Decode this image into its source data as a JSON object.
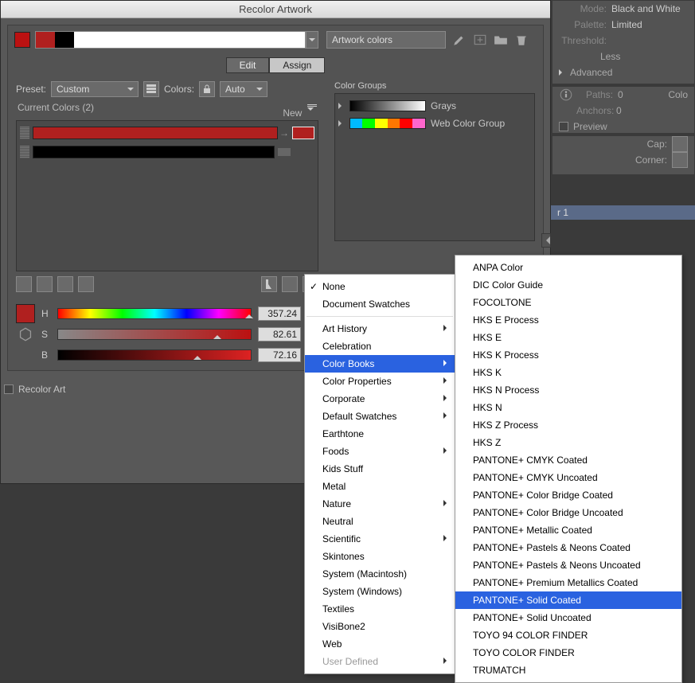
{
  "dialog_title": "Recolor Artwork",
  "top": {
    "artwork_field": "Artwork colors"
  },
  "tabs": {
    "edit": "Edit",
    "assign": "Assign"
  },
  "preset": {
    "label": "Preset:",
    "value": "Custom",
    "colors_label": "Colors:",
    "colors_value": "Auto"
  },
  "current": {
    "label": "Current Colors (2)",
    "new": "New"
  },
  "color_rows": [
    {
      "current": "#b0201f",
      "target": "#b0201f"
    },
    {
      "current": "#000000",
      "target": null
    }
  ],
  "hsb": {
    "swatch": "#b0201f",
    "H": {
      "label": "H",
      "value": "357.24",
      "unit": "°"
    },
    "S": {
      "label": "S",
      "value": "82.61",
      "unit": "%"
    },
    "B": {
      "label": "B",
      "value": "72.16",
      "unit": "%"
    }
  },
  "recolor_label": "Recolor Art",
  "groups": {
    "label": "Color Groups",
    "items": [
      {
        "name": "Grays"
      },
      {
        "name": "Web Color Group"
      }
    ]
  },
  "side": {
    "mode_label": "Mode:",
    "mode_value": "Black and White",
    "palette_label": "Palette:",
    "palette_value": "Limited",
    "threshold_label": "Threshold:",
    "threshold_less": "Less",
    "advanced": "Advanced",
    "paths_label": "Paths:",
    "paths_value": "0",
    "colors_label": "Colo",
    "anchors_label": "Anchors:",
    "anchors_value": "0",
    "preview": "Preview",
    "cap_label": "Cap:",
    "corner_label": "Corner:"
  },
  "layer": "r 1",
  "menu1": [
    {
      "label": "None",
      "checked": true
    },
    {
      "label": "Document Swatches"
    },
    {
      "sep": true
    },
    {
      "label": "Art History",
      "sub": true
    },
    {
      "label": "Celebration"
    },
    {
      "label": "Color Books",
      "sub": true,
      "selected": true
    },
    {
      "label": "Color Properties",
      "sub": true
    },
    {
      "label": "Corporate",
      "sub": true
    },
    {
      "label": "Default Swatches",
      "sub": true
    },
    {
      "label": "Earthtone"
    },
    {
      "label": "Foods",
      "sub": true
    },
    {
      "label": "Kids Stuff"
    },
    {
      "label": "Metal"
    },
    {
      "label": "Nature",
      "sub": true
    },
    {
      "label": "Neutral"
    },
    {
      "label": "Scientific",
      "sub": true
    },
    {
      "label": "Skintones"
    },
    {
      "label": "System (Macintosh)"
    },
    {
      "label": "System (Windows)"
    },
    {
      "label": "Textiles"
    },
    {
      "label": "VisiBone2"
    },
    {
      "label": "Web"
    },
    {
      "label": "User Defined",
      "sub": true,
      "disabled": true
    }
  ],
  "menu2": [
    "ANPA Color",
    "DIC Color Guide",
    "FOCOLTONE",
    "HKS E Process",
    "HKS E",
    "HKS K Process",
    "HKS K",
    "HKS N Process",
    "HKS N",
    "HKS Z Process",
    "HKS Z",
    "PANTONE+ CMYK Coated",
    "PANTONE+ CMYK Uncoated",
    "PANTONE+ Color Bridge Coated",
    "PANTONE+ Color Bridge Uncoated",
    "PANTONE+ Metallic Coated",
    "PANTONE+ Pastels & Neons Coated",
    "PANTONE+ Pastels & Neons Uncoated",
    "PANTONE+ Premium Metallics Coated",
    "PANTONE+ Solid Coated",
    "PANTONE+ Solid Uncoated",
    "TOYO 94 COLOR FINDER",
    "TOYO COLOR FINDER",
    "TRUMATCH"
  ],
  "menu2_selected": "PANTONE+ Solid Coated"
}
